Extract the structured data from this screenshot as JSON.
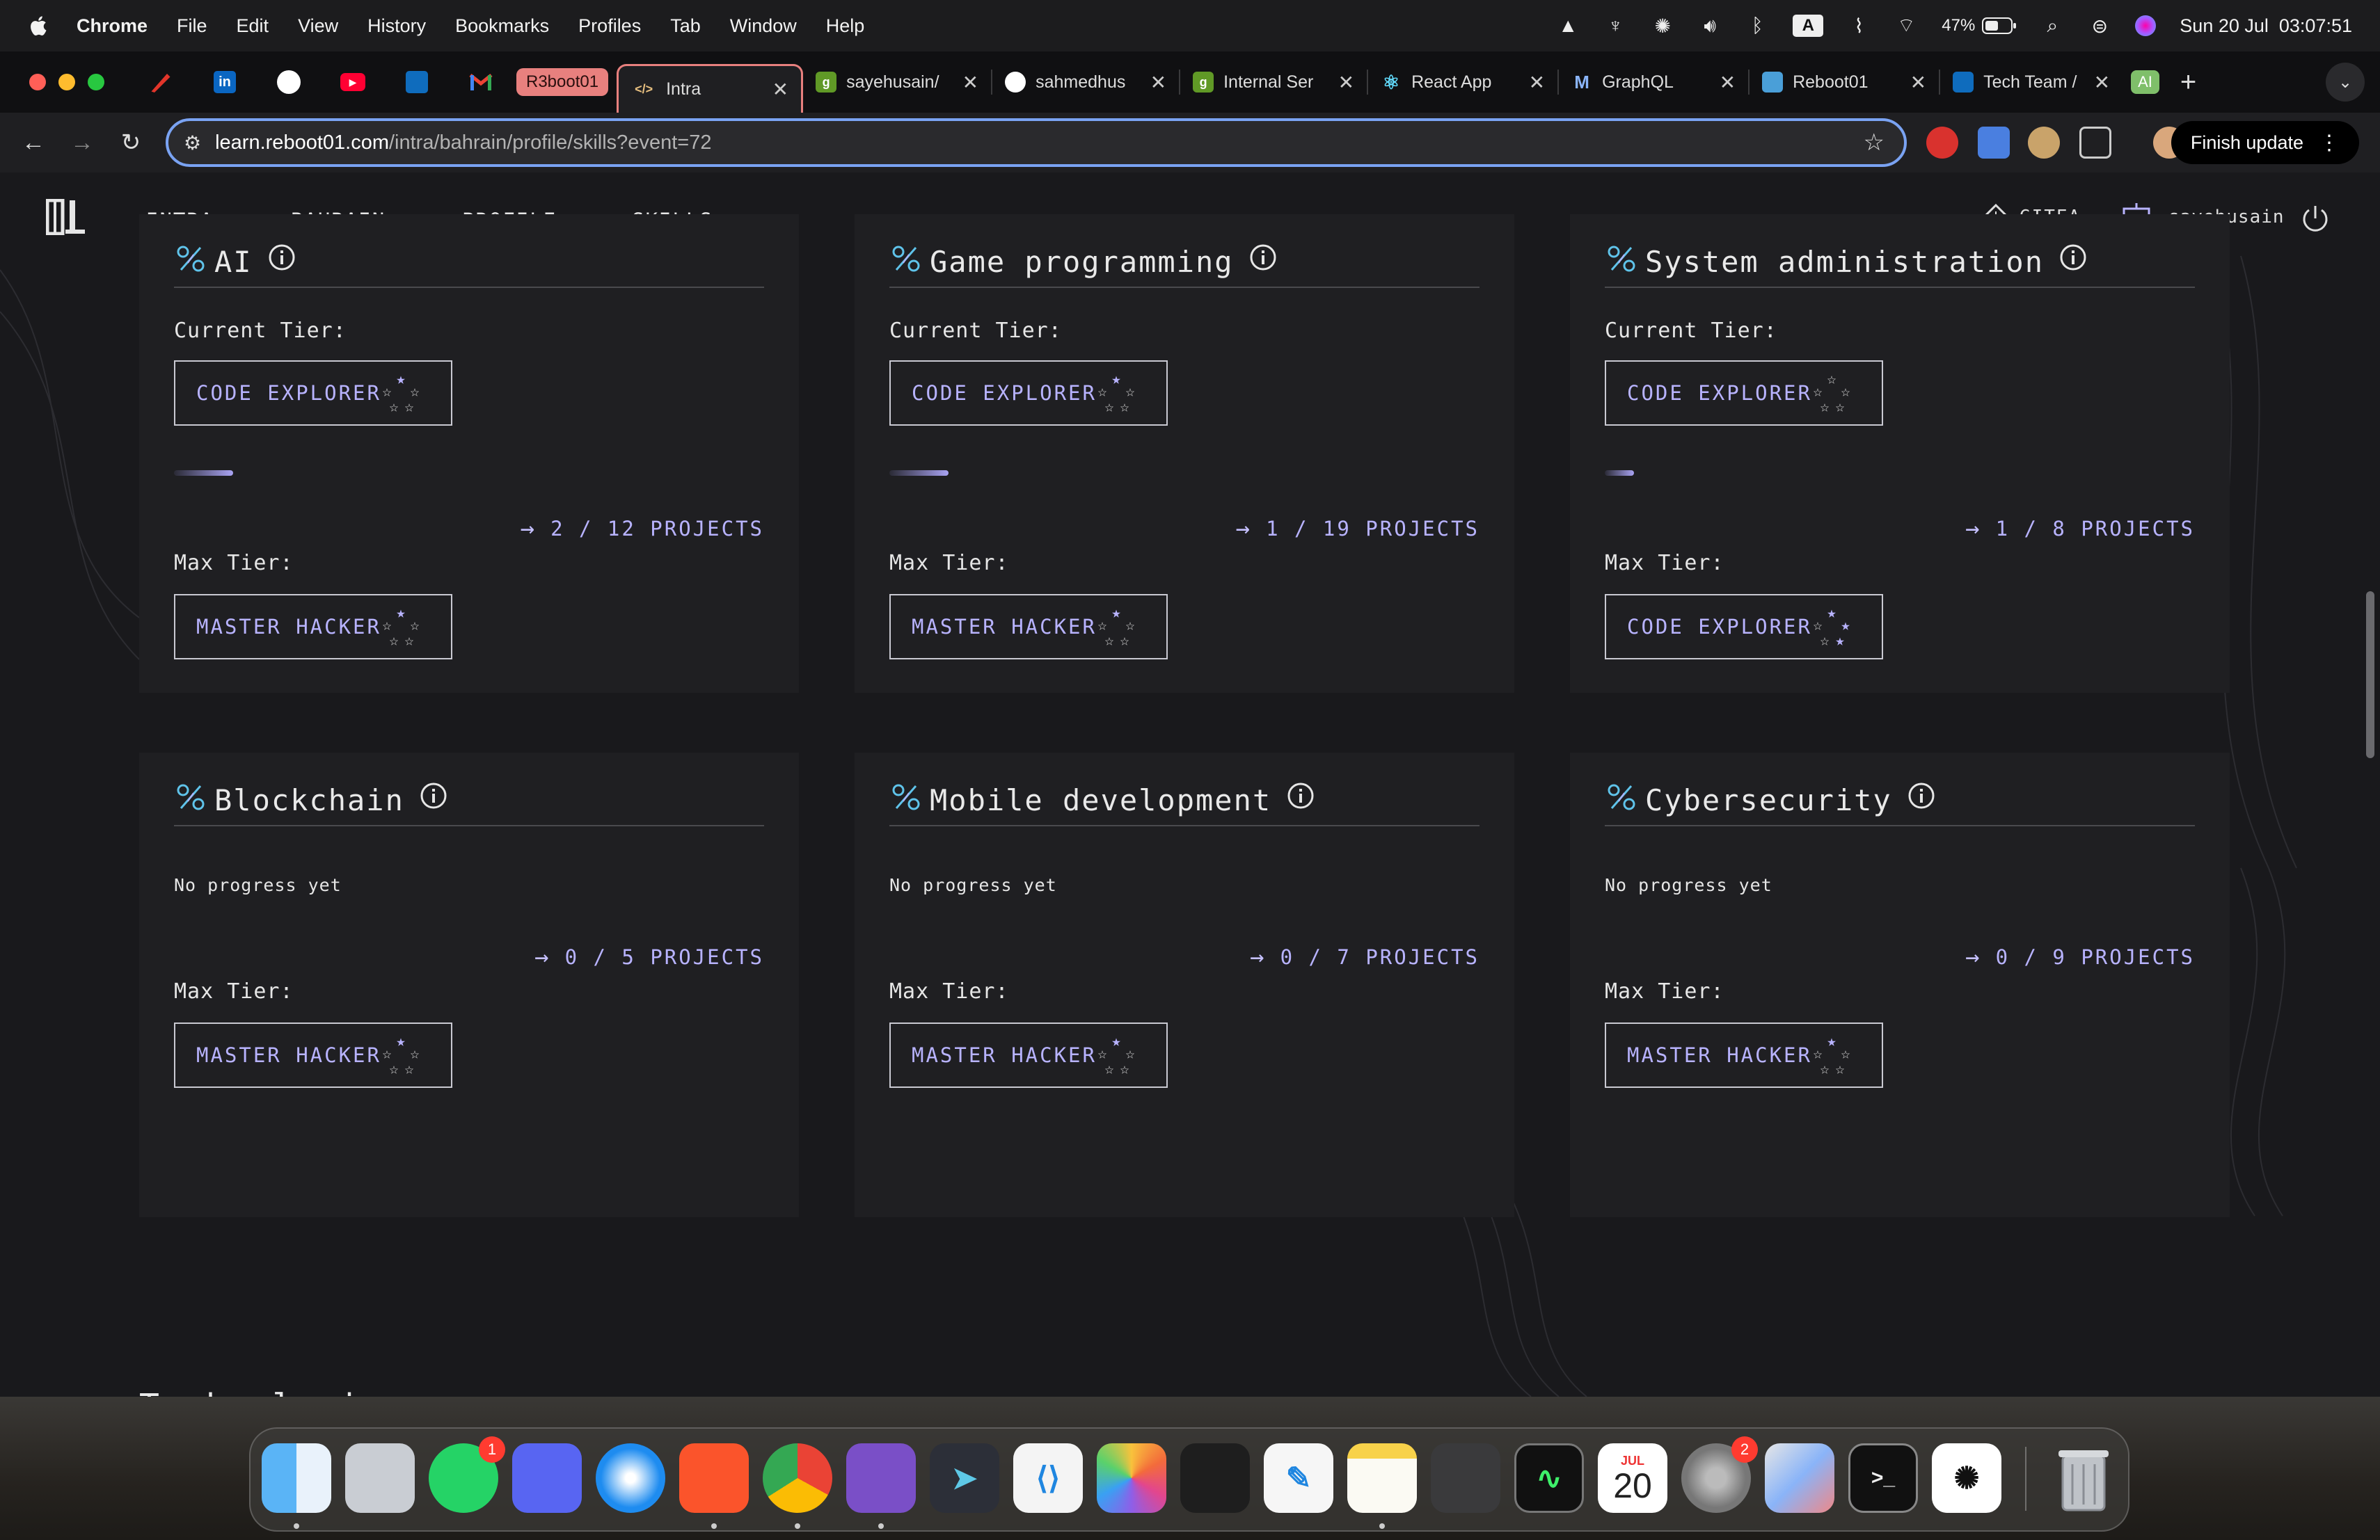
{
  "menubar": {
    "app": "Chrome",
    "items": [
      "File",
      "Edit",
      "View",
      "History",
      "Bookmarks",
      "Profiles",
      "Tab",
      "Window",
      "Help"
    ],
    "battery": "47%",
    "keyboard": "A",
    "datetime": "Sun 20 Jul  03:07:51"
  },
  "tabs": {
    "group_label": "R3boot01",
    "items": [
      {
        "label": "Intra",
        "icon": "code-icon",
        "active": true
      },
      {
        "label": "sayehusain/",
        "icon": "gitea-icon"
      },
      {
        "label": "sahmedhus",
        "icon": "github-icon"
      },
      {
        "label": "Internal Ser",
        "icon": "gitea-icon"
      },
      {
        "label": "React App",
        "icon": "react-icon"
      },
      {
        "label": "GraphQL",
        "icon": "m-icon"
      },
      {
        "label": "Reboot01",
        "icon": "chart-icon"
      },
      {
        "label": "Tech Team /",
        "icon": "outlook-icon"
      }
    ],
    "ai_label": "AI",
    "new_tab": "+"
  },
  "address": {
    "host": "learn.reboot01.com",
    "path": "/intra/bahrain/profile/skills?event=72",
    "finish_update": "Finish update"
  },
  "nav": {
    "crumbs": [
      "INTRA",
      "BAHRAIN",
      "PROFILE",
      "SKILLS"
    ],
    "separator": ">",
    "gitea": "GITEA",
    "username": "sayehusain"
  },
  "labels": {
    "current_tier": "Current Tier:",
    "max_tier": "Max Tier:",
    "no_progress": "No progress yet"
  },
  "skills": [
    {
      "name": "AI",
      "current": "CODE EXPLORER",
      "current_stars": 1,
      "progress": 0.1,
      "projects": "2 / 12 PROJECTS",
      "max": "MASTER HACKER",
      "max_stars": 1
    },
    {
      "name": "Game programming",
      "current": "CODE EXPLORER",
      "current_stars": 1,
      "progress": 0.1,
      "projects": "1 / 19 PROJECTS",
      "max": "MASTER HACKER",
      "max_stars": 1
    },
    {
      "name": "System administration",
      "current": "CODE EXPLORER",
      "current_stars": 0,
      "progress": 0.05,
      "projects": "1 / 8 PROJECTS",
      "max": "CODE EXPLORER",
      "max_stars": 3
    },
    {
      "name": "Blockchain",
      "current": null,
      "projects": "0 / 5 PROJECTS",
      "max": "MASTER HACKER",
      "max_stars": 1
    },
    {
      "name": "Mobile development",
      "current": null,
      "projects": "0 / 7 PROJECTS",
      "max": "MASTER HACKER",
      "max_stars": 1
    },
    {
      "name": "Cybersecurity",
      "current": null,
      "projects": "0 / 9 PROJECTS",
      "max": "MASTER HACKER",
      "max_stars": 1
    }
  ],
  "technologies_heading": "Technologies",
  "dock": {
    "apps": [
      "Finder",
      "Launchpad",
      "WhatsApp",
      "Discord",
      "Safari",
      "Brave",
      "Chrome",
      "GitHub Desktop",
      "Prompt",
      "VS Code",
      "Photos",
      "Figma",
      "Freeform",
      "Notes",
      "Calculator",
      "Activity Monitor",
      "Calendar",
      "System Settings",
      "iPhone Mirroring",
      "Terminal",
      "ChatGPT",
      "Trash"
    ],
    "whatsapp_badge": "1",
    "settings_badge": "2",
    "calendar_month": "JUL",
    "calendar_day": "20"
  },
  "colors": {
    "accent": "#b8b3ff",
    "tab_active_border": "#e8807e",
    "omnibox_border": "#7aa3f3",
    "card_bg": "#1f1f22"
  }
}
